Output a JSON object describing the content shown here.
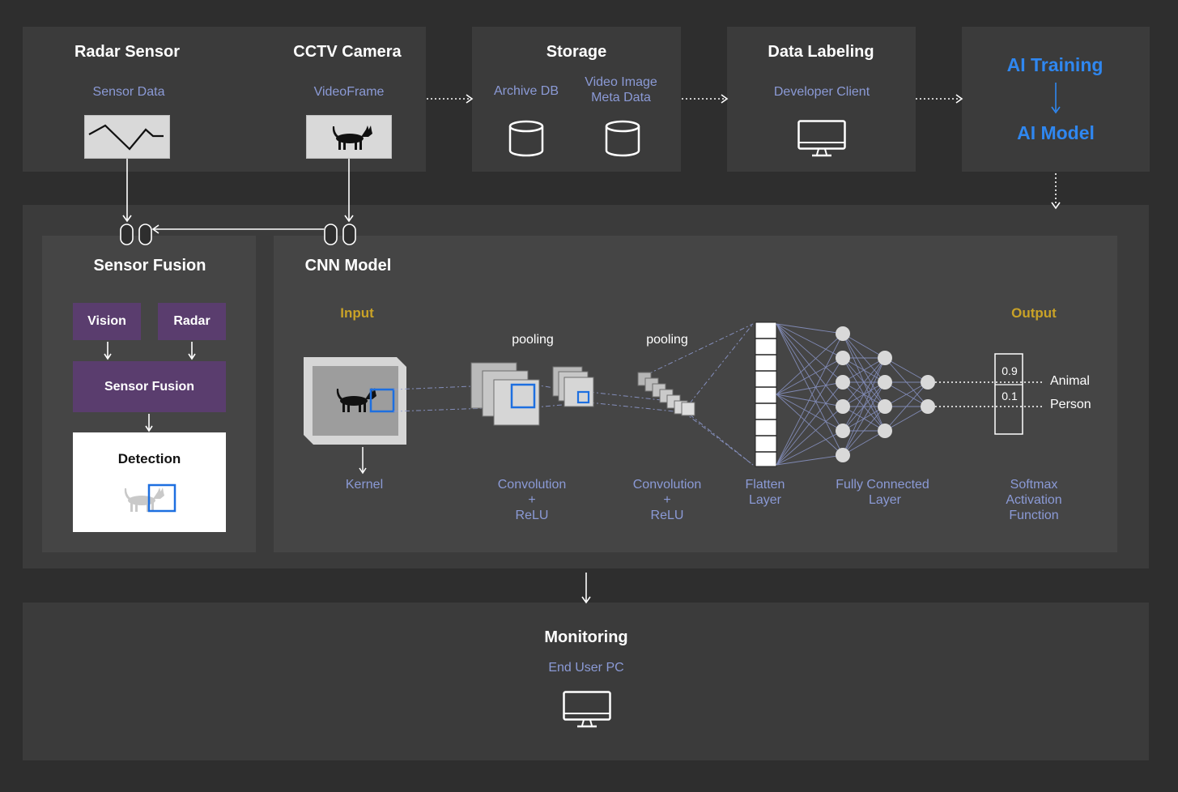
{
  "top": {
    "radar": {
      "title": "Radar Sensor",
      "sub": "Sensor Data"
    },
    "cctv": {
      "title": "CCTV Camera",
      "sub": "VideoFrame"
    },
    "storage": {
      "title": "Storage",
      "left": "Archive DB",
      "right_line1": "Video Image",
      "right_line2": "Meta Data"
    },
    "labeling": {
      "title": "Data Labeling",
      "sub": "Developer Client"
    },
    "training": {
      "title": "AI Training",
      "model": "AI Model"
    }
  },
  "fusion": {
    "title": "Sensor Fusion",
    "vision": "Vision",
    "radar": "Radar",
    "fusion_box": "Sensor Fusion",
    "detection": "Detection"
  },
  "cnn": {
    "title": "CNN Model",
    "input": "Input",
    "output": "Output",
    "pooling1": "pooling",
    "pooling2": "pooling",
    "kernel": "Kernel",
    "conv1": [
      "Convolution",
      "+",
      "ReLU"
    ],
    "conv2": [
      "Convolution",
      "+",
      "ReLU"
    ],
    "flatten": [
      "Flatten",
      "Layer"
    ],
    "fc": [
      "Fully Connected",
      "Layer"
    ],
    "softmax": [
      "Softmax",
      "Activation",
      "Function"
    ],
    "prob1": "0.9",
    "prob2": "0.1",
    "class1": "Animal",
    "class2": "Person"
  },
  "monitoring": {
    "title": "Monitoring",
    "sub": "End User PC"
  },
  "colors": {
    "accent_blue": "#2f87f0",
    "purple": "#5a3d6e",
    "gold": "#c9a227",
    "sub_text": "#8b9ad6"
  }
}
